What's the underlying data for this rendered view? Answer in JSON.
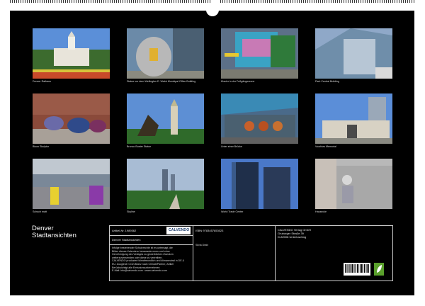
{
  "calendar": {
    "title_line1": "Denver",
    "title_line2": "Stadtansichten",
    "captions": [
      "Denver Rathaus",
      "Statue vor dem Wellington E. Webb Municipal Office Building",
      "Klavier in der Fußgängerzone",
      "Park Central Building",
      "Bison Skulptur",
      "Bronco Buster Statue",
      "Unter einer Brücke",
      "Voorhies Memorial",
      "Schach matt",
      "Skyline",
      "World Trade Center",
      "Hausecke"
    ]
  },
  "info": {
    "article_label": "Artikel-Nr. 1989362",
    "logo_text": "CALVENDO",
    "isbn": "ISBN 9783457853023",
    "publisher_line1": "CALVENDO Verlag GmbH",
    "publisher_line2": "Gruburger Straße 39",
    "publisher_line3": "D-82008 Unterhaching",
    "calendar_name": "Denver Stadtansichten",
    "author": "Silvia Drafz",
    "legal_line1": "Infolge bestehender Schutzrechte ist es untersagt, die",
    "legal_line2": "Bilder dieses Kalenders herauszutrennen und ohne",
    "legal_line3": "Genehmigung des Verlages zu gewerblichen Zwecken",
    "legal_line4": "weiterzuverwenden oder diese zu vertreiben.",
    "legal_line5": "CALVENDO produziert klimafreundlich und klimaneutral in DE &",
    "legal_line6": "EU. Ausgleich CO2-Bilanz nach ClimatePartner, Artikel",
    "legal_line7": "Berücksichtigt alle Emissionsunternehmen",
    "legal_line8": "E-Mail: info@calvendo.com • www.calvendo.com"
  }
}
